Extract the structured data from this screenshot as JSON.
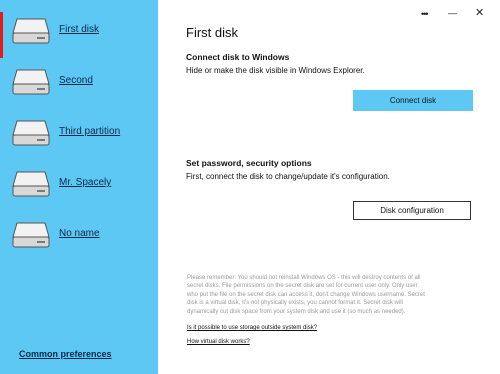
{
  "sidebar": {
    "items": [
      {
        "label": "First disk",
        "selected": true
      },
      {
        "label": "Second",
        "selected": false
      },
      {
        "label": "Third partition",
        "selected": false
      },
      {
        "label": "Mr. Spacely",
        "selected": false
      },
      {
        "label": "No name",
        "selected": false
      }
    ],
    "common_preferences": "Common preferences"
  },
  "window": {
    "more_icon": "•••",
    "minimize_icon": "—",
    "close_icon": "✕"
  },
  "main": {
    "title": "First disk",
    "connect_section": {
      "heading": "Connect disk to Windows",
      "description": "Hide or make the disk visible in Windows Explorer.",
      "button": "Connect disk"
    },
    "security_section": {
      "heading": "Set password, security options",
      "description": "First, connect the disk to change/update it's configuration.",
      "button": "Disk configuration"
    },
    "note_lines": [
      "Please remember: You should not reinstall Windows OS - this will destroy contents of all",
      "secret disks. File permissions on the secret disk are set for current user only. Only user",
      "who put the file on the secret disk can access it, don't change Windows username. Secret",
      "disk is a virtual disk, it's not physically exists, you cannot format it. Secret disk will",
      "dynamically cut disk space from your system disk and use it (so much as needed)."
    ],
    "links": [
      "Is it possible to use storage outside system disk?",
      "How virtual disk works?"
    ]
  },
  "colors": {
    "sidebar_bg": "#5ec8f5",
    "selected_indicator": "#e41b1b",
    "primary_button": "#5ec8f5"
  }
}
